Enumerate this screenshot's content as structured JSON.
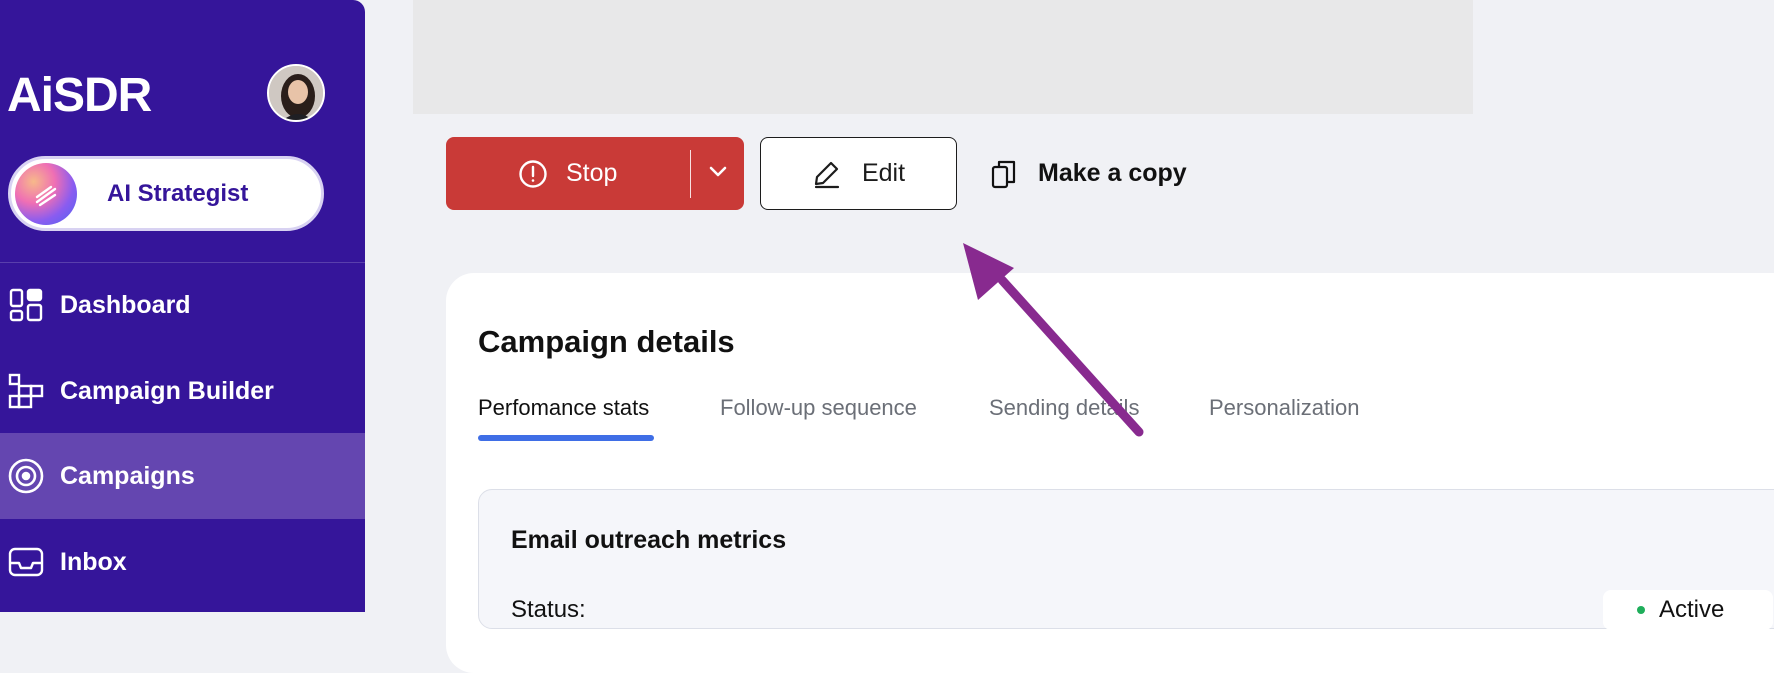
{
  "app": {
    "logo": "AiSDR"
  },
  "sidebar": {
    "strategist_label": "AI Strategist",
    "items": [
      {
        "label": "Dashboard",
        "icon": "dashboard-icon"
      },
      {
        "label": "Campaign Builder",
        "icon": "campaign-builder-icon"
      },
      {
        "label": "Campaigns",
        "icon": "target-icon",
        "active": true
      },
      {
        "label": "Inbox",
        "icon": "inbox-icon"
      }
    ]
  },
  "actions": {
    "stop_label": "Stop",
    "edit_label": "Edit",
    "copy_label": "Make a copy"
  },
  "card": {
    "title": "Campaign details",
    "tabs": [
      {
        "label": "Perfomance stats",
        "active": true
      },
      {
        "label": "Follow-up sequence"
      },
      {
        "label": "Sending details"
      },
      {
        "label": "Personalization"
      }
    ],
    "metrics": {
      "title": "Email outreach metrics",
      "status_label": "Status:",
      "status_value": "Active"
    }
  },
  "colors": {
    "sidebar": "#35159a",
    "stop_button": "#c93a37",
    "tab_underline": "#3f6ee6",
    "annotation_arrow": "#882a8f"
  }
}
